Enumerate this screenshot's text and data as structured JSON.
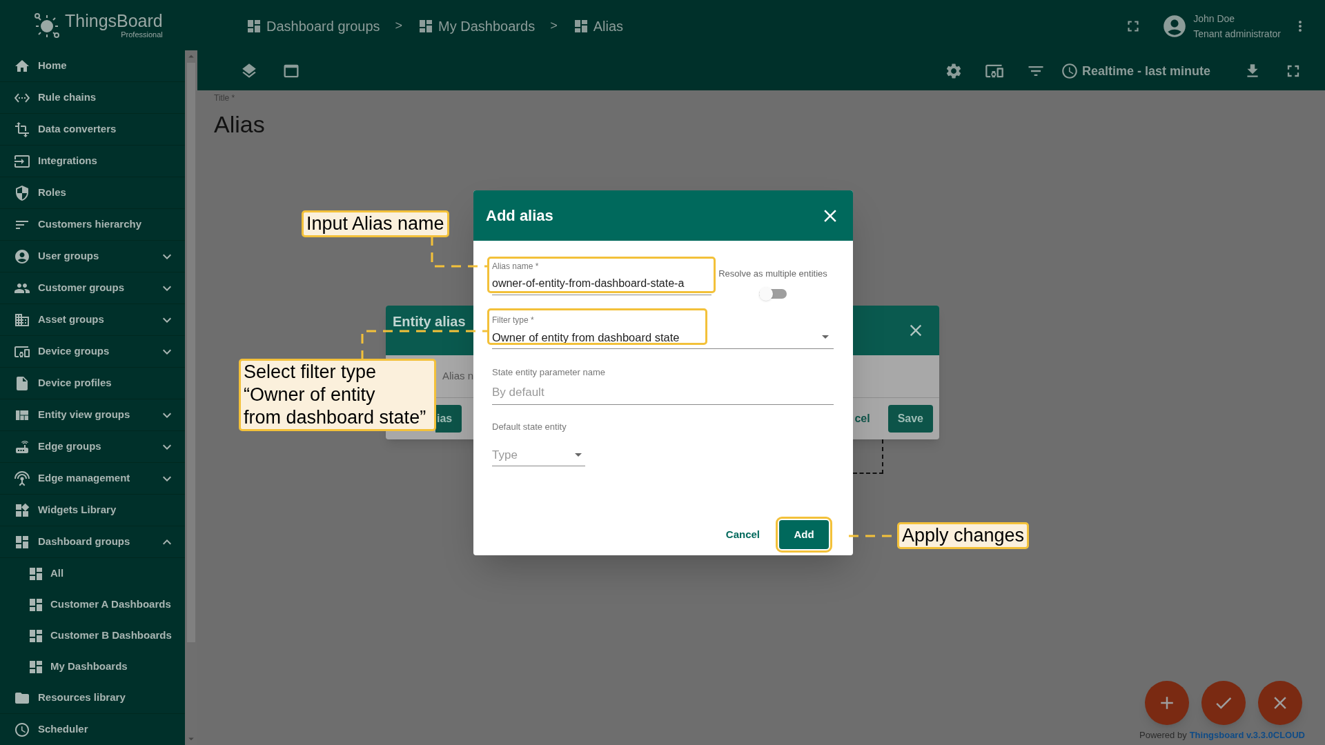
{
  "logo": {
    "name": "ThingsBoard",
    "edition": "Professional"
  },
  "breadcrumbs": [
    {
      "label": "Dashboard groups"
    },
    {
      "label": "My Dashboards"
    },
    {
      "label": "Alias"
    }
  ],
  "breadcrumb_separator": ">",
  "user": {
    "name": "John Doe",
    "role": "Tenant administrator"
  },
  "toolbar": {
    "timewindow": "Realtime - last minute"
  },
  "sidebar": {
    "items": [
      {
        "label": "Home",
        "kind": "link"
      },
      {
        "label": "Rule chains",
        "kind": "link"
      },
      {
        "label": "Data converters",
        "kind": "link"
      },
      {
        "label": "Integrations",
        "kind": "link"
      },
      {
        "label": "Roles",
        "kind": "link"
      },
      {
        "label": "Customers hierarchy",
        "kind": "link"
      },
      {
        "label": "User groups",
        "kind": "group",
        "expanded": false
      },
      {
        "label": "Customer groups",
        "kind": "group",
        "expanded": false
      },
      {
        "label": "Asset groups",
        "kind": "group",
        "expanded": false
      },
      {
        "label": "Device groups",
        "kind": "group",
        "expanded": false
      },
      {
        "label": "Device profiles",
        "kind": "link"
      },
      {
        "label": "Entity view groups",
        "kind": "group",
        "expanded": false
      },
      {
        "label": "Edge groups",
        "kind": "group",
        "expanded": false
      },
      {
        "label": "Edge management",
        "kind": "group",
        "expanded": false
      },
      {
        "label": "Widgets Library",
        "kind": "link"
      },
      {
        "label": "Dashboard groups",
        "kind": "group",
        "expanded": true,
        "children": [
          {
            "label": "All"
          },
          {
            "label": "Customer A Dashboards"
          },
          {
            "label": "Customer B Dashboards"
          },
          {
            "label": "My Dashboards"
          }
        ]
      },
      {
        "label": "Resources library",
        "kind": "link"
      },
      {
        "label": "Scheduler",
        "kind": "link"
      }
    ]
  },
  "page": {
    "title_label": "Title *",
    "title": "Alias"
  },
  "entity_alias_dialog": {
    "title": "Entity alias",
    "column_label": "Alias n",
    "add_button": "ias",
    "cancel_button": "cel",
    "save_button": "Save"
  },
  "add_alias_dialog": {
    "title": "Add alias",
    "alias_name": {
      "label": "Alias name *",
      "value": "owner-of-entity-from-dashboard-state-a"
    },
    "resolve_multiple": {
      "label": "Resolve as multiple entities",
      "on": false
    },
    "filter_type": {
      "label": "Filter type *",
      "value": "Owner of entity from dashboard state"
    },
    "state_param": {
      "label": "State entity parameter name",
      "placeholder": "By default"
    },
    "default_state_entity": {
      "label": "Default state entity",
      "type_placeholder": "Type"
    },
    "cancel": "Cancel",
    "add": "Add"
  },
  "callouts": [
    {
      "text": "Input Alias name"
    },
    {
      "text": "Select filter type\n“Owner of entity\nfrom dashboard state”"
    },
    {
      "text": "Apply changes"
    }
  ],
  "footer": {
    "prefix": "Powered by",
    "link": "Thingsboard v.3.3.0CLOUD"
  }
}
